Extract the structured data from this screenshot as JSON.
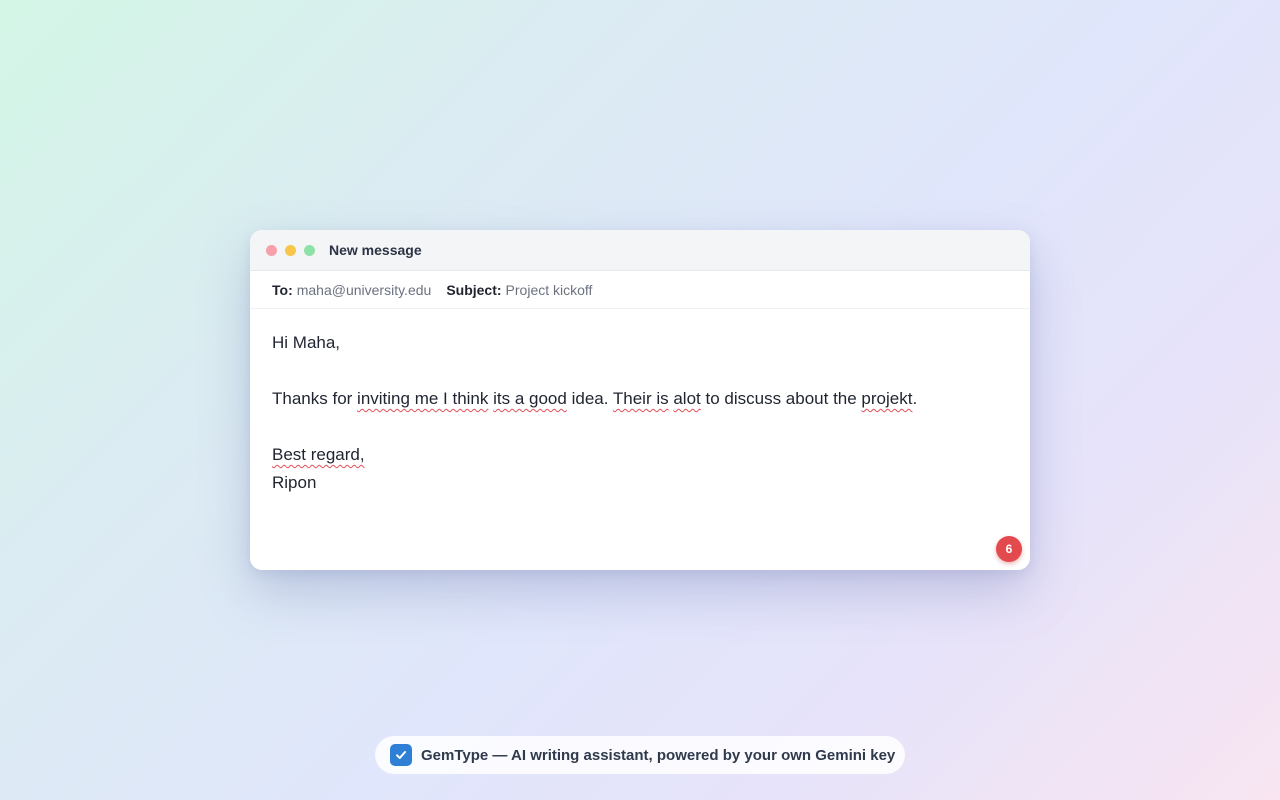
{
  "window": {
    "title": "New message",
    "traffic_lights": {
      "close_color": "#f7a0ab",
      "minimize_color": "#f7c64a",
      "maximize_color": "#8fe2a7"
    }
  },
  "header": {
    "to_label": "To:",
    "to_value": "maha@university.edu",
    "subject_label": "Subject:",
    "subject_value": "Project kickoff"
  },
  "body": {
    "greeting": "Hi Maha,",
    "line2": {
      "seg1": "Thanks for ",
      "err1": "inviting me I think",
      "seg2": " ",
      "err2": "its a good",
      "seg3": " idea. ",
      "err3": "Their is",
      "seg4": " ",
      "err4": "alot",
      "seg5": " to discuss about the ",
      "err5": "projekt",
      "seg6": "."
    },
    "closing": "Best regard,",
    "signature": "Ripon"
  },
  "issue_badge": {
    "count": "6",
    "color": "#e24a4d"
  },
  "footer": {
    "icon": "checkmark-icon",
    "text": "GemType — AI writing assistant, powered by your own Gemini key",
    "accent": "#2f7fd6"
  }
}
